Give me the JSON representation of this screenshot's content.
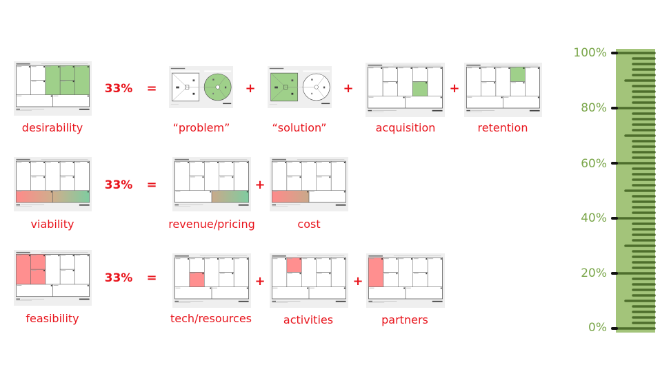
{
  "colors": {
    "accent_red": "#e8141c",
    "green_fill": "#9fd08a",
    "red_fill": "#ff8f8f",
    "ruler_bg": "#a3c47a",
    "ruler_tick": "#4e6e2c",
    "ruler_label": "#7aa64a"
  },
  "rows": [
    {
      "name": "desirability",
      "label": "desirability",
      "percent": "33%",
      "equals": "=",
      "components": [
        {
          "label": "“problem”",
          "canvas": "value-proposition",
          "highlight": "customer-circle",
          "fill": "green"
        },
        {
          "label": "“solution”",
          "canvas": "value-proposition",
          "highlight": "value-square",
          "fill": "green"
        },
        {
          "label": "acquisition",
          "canvas": "business-model",
          "highlight": [
            "channels"
          ],
          "fill": "green"
        },
        {
          "label": "retention",
          "canvas": "business-model",
          "highlight": [
            "customer-relationships"
          ],
          "fill": "green"
        }
      ],
      "summary_highlight": [
        "value-propositions",
        "customer-relationships",
        "channels",
        "customer-segments"
      ],
      "summary_fill": "green"
    },
    {
      "name": "viability",
      "label": "viability",
      "percent": "33%",
      "equals": "=",
      "components": [
        {
          "label": "revenue/pricing",
          "canvas": "business-model",
          "highlight": [
            "revenue-streams"
          ],
          "fill": "gradient-tan-green"
        },
        {
          "label": "cost",
          "canvas": "business-model",
          "highlight": [
            "cost-structure"
          ],
          "fill": "gradient-red-tan"
        }
      ],
      "summary_highlight": [
        "cost-structure",
        "revenue-streams"
      ],
      "summary_fill": "gradient-red-green"
    },
    {
      "name": "feasibility",
      "label": "feasibility",
      "percent": "33%",
      "equals": "=",
      "components": [
        {
          "label": "tech/resources",
          "canvas": "business-model",
          "highlight": [
            "key-resources"
          ],
          "fill": "red"
        },
        {
          "label": "activities",
          "canvas": "business-model",
          "highlight": [
            "key-activities"
          ],
          "fill": "red"
        },
        {
          "label": "partners",
          "canvas": "business-model",
          "highlight": [
            "key-partners"
          ],
          "fill": "red"
        }
      ],
      "summary_highlight": [
        "key-partners",
        "key-activities",
        "key-resources"
      ],
      "summary_fill": "red"
    }
  ],
  "operators": {
    "plus": "+"
  },
  "ruler": {
    "labels": [
      "100%",
      "80%",
      "60%",
      "40%",
      "20%",
      "0%"
    ],
    "min": 0,
    "max": 100,
    "major_step": 20,
    "minor_step": 2,
    "medium_step": 10
  }
}
